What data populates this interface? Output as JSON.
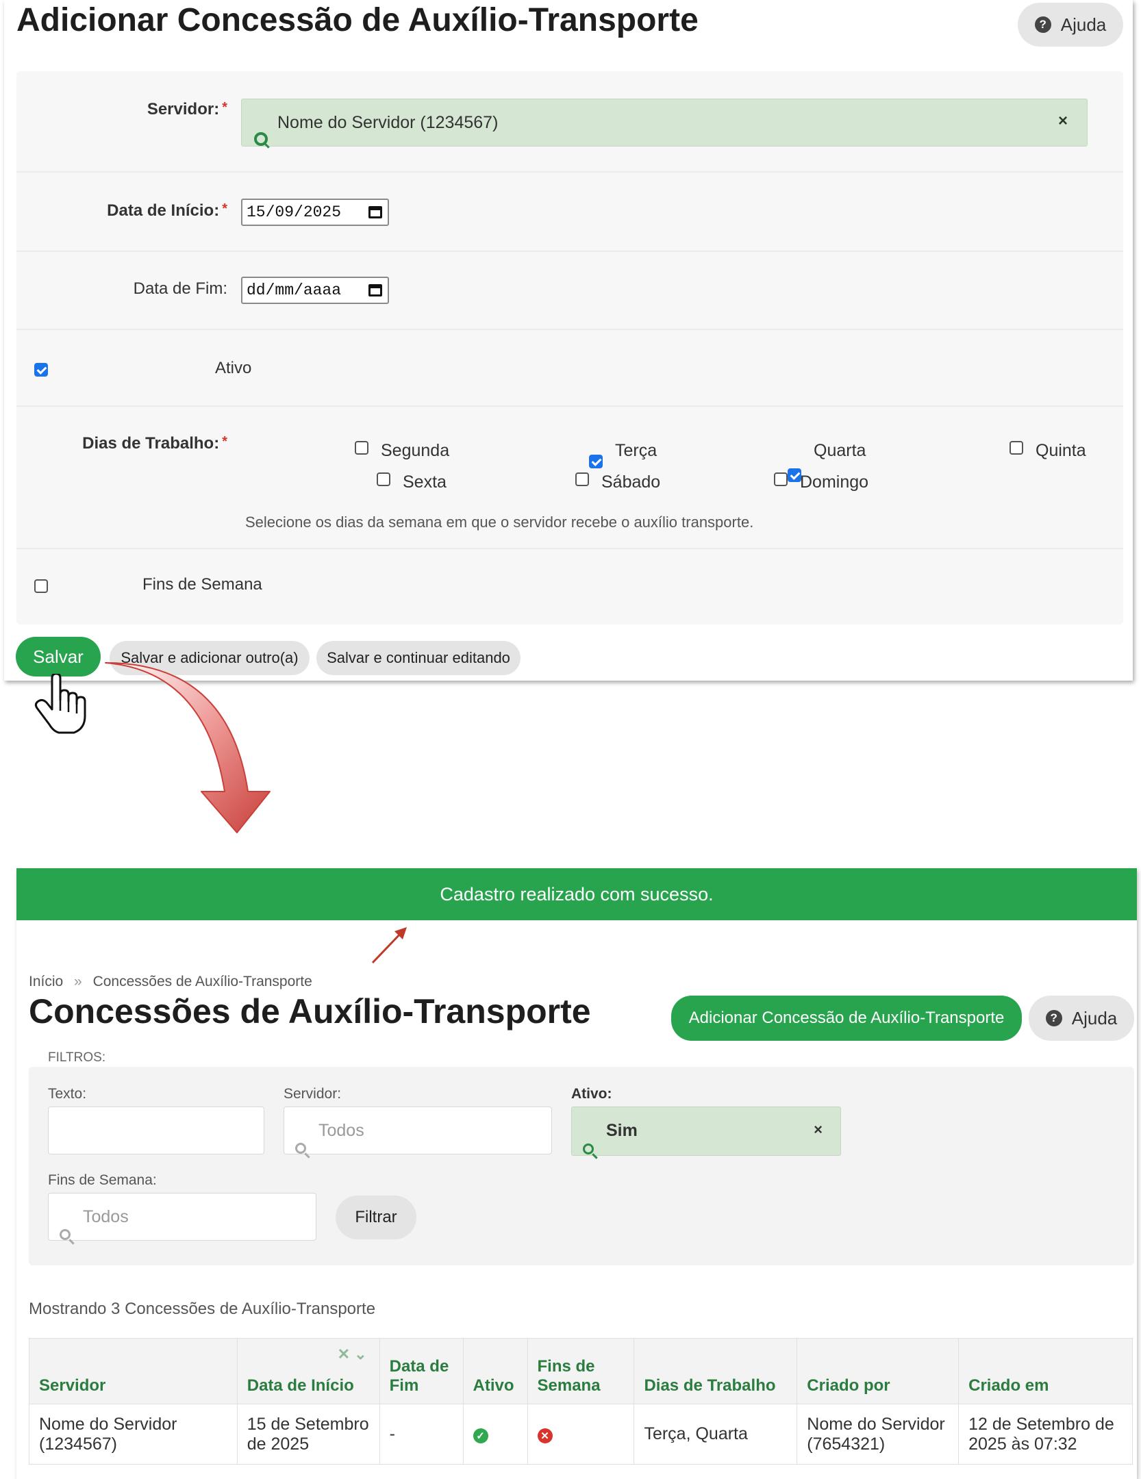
{
  "add_form": {
    "title": "Adicionar Concessão de Auxílio-Transporte",
    "help_label": "Ajuda",
    "servidor": {
      "label": "Servidor:",
      "value": "Nome do Servidor (1234567)",
      "clear": "×"
    },
    "data_inicio": {
      "label": "Data de Início:",
      "value": "15/09/2025"
    },
    "data_fim": {
      "label": "Data de Fim:",
      "placeholder": "dd/mm/aaaa"
    },
    "ativo": {
      "label": "Ativo",
      "checked": true
    },
    "dias_trabalho": {
      "label": "Dias de Trabalho:",
      "days": [
        {
          "label": "Segunda",
          "checked": false
        },
        {
          "label": "Terça",
          "checked": true
        },
        {
          "label": "Quarta",
          "checked": true
        },
        {
          "label": "Quinta",
          "checked": false
        },
        {
          "label": "Sexta",
          "checked": false
        },
        {
          "label": "Sábado",
          "checked": false
        },
        {
          "label": "Domingo",
          "checked": false
        }
      ],
      "help_text": "Selecione os dias da semana em que o servidor recebe o auxílio transporte."
    },
    "fins_de_semana": {
      "label": "Fins de Semana",
      "checked": false
    },
    "buttons": {
      "save": "Salvar",
      "save_add": "Salvar e adicionar outro(a)",
      "save_continue": "Salvar e continuar editando"
    }
  },
  "list_page": {
    "success_message": "Cadastro realizado com sucesso.",
    "breadcrumb": {
      "home": "Início",
      "separator": "»",
      "current": "Concessões de Auxílio-Transporte"
    },
    "title": "Concessões de Auxílio-Transporte",
    "add_button": "Adicionar Concessão de Auxílio-Transporte",
    "help_label": "Ajuda",
    "filters": {
      "heading": "FILTROS:",
      "texto": {
        "label": "Texto:",
        "value": ""
      },
      "servidor": {
        "label": "Servidor:",
        "placeholder": "Todos"
      },
      "ativo": {
        "label": "Ativo:",
        "value": "Sim",
        "clear": "×"
      },
      "fins_semana": {
        "label": "Fins de Semana:",
        "placeholder": "Todos"
      },
      "filter_button": "Filtrar"
    },
    "count_text": "Mostrando 3 Concessões de Auxílio-Transporte",
    "table": {
      "headers": [
        "Servidor",
        "Data de Início",
        "Data de Fim",
        "Ativo",
        "Fins de Semana",
        "Dias de Trabalho",
        "Criado por",
        "Criado em"
      ],
      "sort_clear": "✕",
      "sort_arrow": "⌄",
      "rows": [
        {
          "servidor": "Nome do Servidor (1234567)",
          "data_inicio": "15 de Setembro de 2025",
          "data_fim": "-",
          "ativo": true,
          "fins_semana": false,
          "dias": "Terça, Quarta",
          "criado_por": "Nome do Servidor (7654321)",
          "criado_em": "12 de Setembro de 2025 às 07:32"
        }
      ]
    }
  },
  "colors": {
    "green": "#28a44e",
    "link_green": "#2a7d3e",
    "select_green": "#d5e7d3",
    "arrow_red": "#d9534f"
  }
}
